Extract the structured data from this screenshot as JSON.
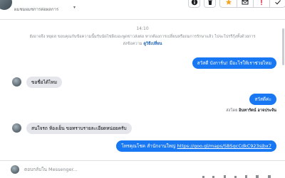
{
  "header": {
    "title": "ผมชมผมชการต่อผลการ",
    "caret": "▾",
    "toolbar": {
      "info": "info-icon",
      "delete": "trash-icon",
      "star": "star-icon",
      "mail": "envelope-icon",
      "flag": "exclamation-icon",
      "done": "check-icon",
      "colors": {
        "star": "#f5a623",
        "flag": "#e41e3f"
      }
    }
  },
  "conversation": {
    "timestamp": "14:10",
    "notice_text": "ยังอาจจึง หยุดส ขอบคุณกับข้อความนี้มรับนัดไข่ผีเบอะพูดข่าวส่งต่อ หากต้องการเปลี่ยนหรือถมการรักษาแล้ว ไปจะโปรรีกุ้งทั้งด้วยการ",
    "notice_text_2": "ส่งข้อความ",
    "notice_link": "ดูวิธีเปลี่ยน",
    "messages": [
      {
        "side": "out",
        "text": "สวัสดี บังการ์น! มีอะไรให้เราช่วยไหม"
      },
      {
        "side": "in",
        "text": "ขอชื่อได้ไหม"
      },
      {
        "side": "out",
        "text": "สวัสดีค่ะ"
      },
      {
        "side": "meta",
        "prefix": "ส่งโดย",
        "name": "อินทารัตน์ อาจประจัน"
      },
      {
        "side": "in",
        "text": "สนใจรถ ห้องเย็น ขอทราบรายละเอียดหน่อยครับ"
      },
      {
        "side": "out",
        "text": "โทรคุณโชค สำนักงานใหญ่ ",
        "link": "https://goo.gl/maps/SBSqcCdkC923sjbx7"
      }
    ]
  },
  "composer": {
    "placeholder": "ตอบกลับใน Messenger..."
  },
  "colors": {
    "accent": "#1877f2",
    "incoming": "#e4e6eb",
    "link": "#1a5fb4"
  }
}
